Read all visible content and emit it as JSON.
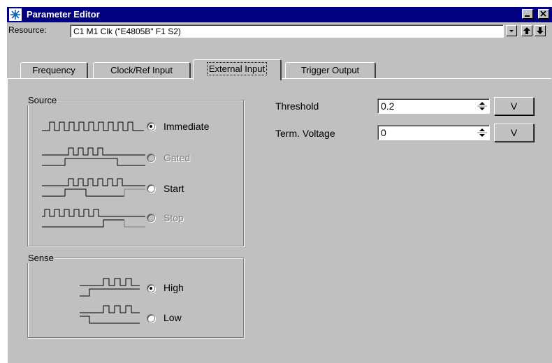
{
  "window": {
    "title": "Parameter Editor",
    "accent": "#000080"
  },
  "resource": {
    "label": "Resource:",
    "value": "C1 M1 Clk (\"E4805B\" F1 S2)"
  },
  "tabs": [
    {
      "label": "Frequency"
    },
    {
      "label": "Clock/Ref Input"
    },
    {
      "label": "External Input",
      "selected": true
    },
    {
      "label": "Trigger Output"
    }
  ],
  "source": {
    "title": "Source",
    "options": [
      {
        "label": "Immediate",
        "checked": true,
        "enabled": true
      },
      {
        "label": "Gated",
        "checked": false,
        "enabled": false
      },
      {
        "label": "Start",
        "checked": false,
        "enabled": true
      },
      {
        "label": "Stop",
        "checked": false,
        "enabled": false
      }
    ]
  },
  "sense": {
    "title": "Sense",
    "options": [
      {
        "label": "High",
        "checked": true
      },
      {
        "label": "Low",
        "checked": false
      }
    ]
  },
  "params": [
    {
      "label": "Threshold",
      "value": "0.2",
      "unit": "V"
    },
    {
      "label": "Term. Voltage",
      "value": "0",
      "unit": "V"
    }
  ]
}
